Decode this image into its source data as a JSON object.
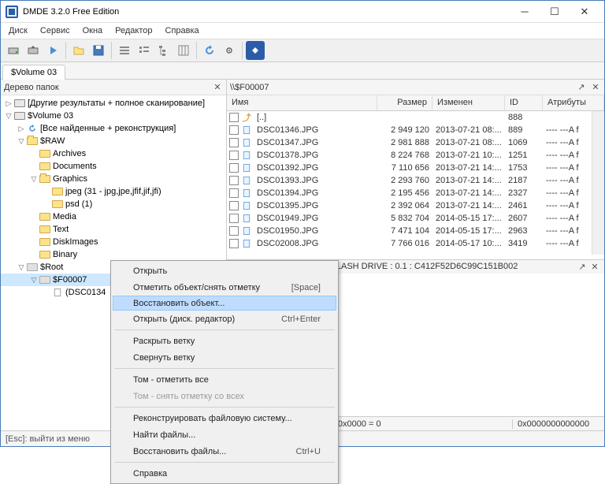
{
  "window": {
    "title": "DMDE 3.2.0 Free Edition"
  },
  "menu": {
    "items": [
      "Диск",
      "Сервис",
      "Окна",
      "Редактор",
      "Справка"
    ]
  },
  "tab": {
    "label": "$Volume 03"
  },
  "tree": {
    "title": "Дерево папок",
    "rows": [
      {
        "indent": 0,
        "twisty": "▷",
        "icon": "drive",
        "label": "[Другие результаты + полное сканирование]"
      },
      {
        "indent": 0,
        "twisty": "▽",
        "icon": "drive",
        "label": "$Volume 03"
      },
      {
        "indent": 1,
        "twisty": "▷",
        "icon": "refresh",
        "label": "[Все найденные + реконструкция]"
      },
      {
        "indent": 1,
        "twisty": "▽",
        "icon": "folder-open",
        "label": "$RAW"
      },
      {
        "indent": 2,
        "twisty": "",
        "icon": "folder",
        "label": "Archives"
      },
      {
        "indent": 2,
        "twisty": "",
        "icon": "folder",
        "label": "Documents"
      },
      {
        "indent": 2,
        "twisty": "▽",
        "icon": "folder-open",
        "label": "Graphics"
      },
      {
        "indent": 3,
        "twisty": "",
        "icon": "folder",
        "label": "jpeg (31 - jpg,jpe,jfif,jif,jfi)"
      },
      {
        "indent": 3,
        "twisty": "",
        "icon": "folder",
        "label": "psd (1)"
      },
      {
        "indent": 2,
        "twisty": "",
        "icon": "folder",
        "label": "Media"
      },
      {
        "indent": 2,
        "twisty": "",
        "icon": "folder",
        "label": "Text"
      },
      {
        "indent": 2,
        "twisty": "",
        "icon": "folder",
        "label": "DiskImages"
      },
      {
        "indent": 2,
        "twisty": "",
        "icon": "folder",
        "label": "Binary"
      },
      {
        "indent": 1,
        "twisty": "▽",
        "icon": "folder-gray",
        "label": "$Root"
      },
      {
        "indent": 2,
        "twisty": "▽",
        "icon": "folder-gray",
        "label": "$F00007",
        "sel": true
      },
      {
        "indent": 3,
        "twisty": "",
        "icon": "file",
        "label": "(DSC0134"
      }
    ]
  },
  "path": {
    "value": "\\\\$F00007"
  },
  "columns": {
    "name": "Имя",
    "size": "Размер",
    "modified": "Изменен",
    "id": "ID",
    "attr": "Атрибуты"
  },
  "files": {
    "up": {
      "label": "[..]",
      "id": "888"
    },
    "rows": [
      {
        "name": "DSC01346.JPG",
        "size": "2 949 120",
        "mod": "2013-07-21 08:...",
        "id": "889",
        "attr": "---- ---A  f"
      },
      {
        "name": "DSC01347.JPG",
        "size": "2 981 888",
        "mod": "2013-07-21 08:...",
        "id": "1069",
        "attr": "---- ---A  f"
      },
      {
        "name": "DSC01378.JPG",
        "size": "8 224 768",
        "mod": "2013-07-21 10:...",
        "id": "1251",
        "attr": "---- ---A  f"
      },
      {
        "name": "DSC01392.JPG",
        "size": "7 110 656",
        "mod": "2013-07-21 14:...",
        "id": "1753",
        "attr": "---- ---A  f"
      },
      {
        "name": "DSC01393.JPG",
        "size": "2 293 760",
        "mod": "2013-07-21 14:...",
        "id": "2187",
        "attr": "---- ---A  f"
      },
      {
        "name": "DSC01394.JPG",
        "size": "2 195 456",
        "mod": "2013-07-21 14:...",
        "id": "2327",
        "attr": "---- ---A  f"
      },
      {
        "name": "DSC01395.JPG",
        "size": "2 392 064",
        "mod": "2013-07-21 14:...",
        "id": "2461",
        "attr": "---- ---A  f"
      },
      {
        "name": "DSC01949.JPG",
        "size": "5 832 704",
        "mod": "2014-05-15 17:...",
        "id": "2607",
        "attr": "---- ---A  f"
      },
      {
        "name": "DSC01950.JPG",
        "size": "7 471 104",
        "mod": "2014-05-15 17:...",
        "id": "2963",
        "attr": "---- ---A  f"
      },
      {
        "name": "DSC02008.JPG",
        "size": "7 766 016",
        "mod": "2014-05-17 10:...",
        "id": "3419",
        "attr": "---- ---A  f"
      }
    ]
  },
  "device_info": "15.5 GB - TOSHIBA USB FLASH DRIVE : 0.1 : C412F52D6C99C151B002",
  "status1": "0x00007180 = 29 056   Pos: 0x0000 = 0",
  "status2": "0x0000000000000",
  "hint": "[Esc]: выйти из меню",
  "context_menu": {
    "items": [
      {
        "label": "Открыть",
        "type": "item"
      },
      {
        "label": "Отметить объект/снять отметку",
        "type": "item",
        "shortcut": "[Space]"
      },
      {
        "label": "Восстановить объект...",
        "type": "item",
        "hovered": true
      },
      {
        "label": "Открыть (диск. редактор)",
        "type": "item",
        "shortcut": "Ctrl+Enter"
      },
      {
        "type": "sep"
      },
      {
        "label": "Раскрыть ветку",
        "type": "item"
      },
      {
        "label": "Свернуть ветку",
        "type": "item"
      },
      {
        "type": "sep"
      },
      {
        "label": "Том - отметить все",
        "type": "item"
      },
      {
        "label": "Том - снять отметку со всех",
        "type": "item",
        "disabled": true
      },
      {
        "type": "sep"
      },
      {
        "label": "Реконструировать файловую систему...",
        "type": "item"
      },
      {
        "label": "Найти файлы...",
        "type": "item"
      },
      {
        "label": "Восстановить файлы...",
        "type": "item",
        "shortcut": "Ctrl+U"
      },
      {
        "type": "sep"
      },
      {
        "label": "Справка",
        "type": "item"
      }
    ]
  }
}
